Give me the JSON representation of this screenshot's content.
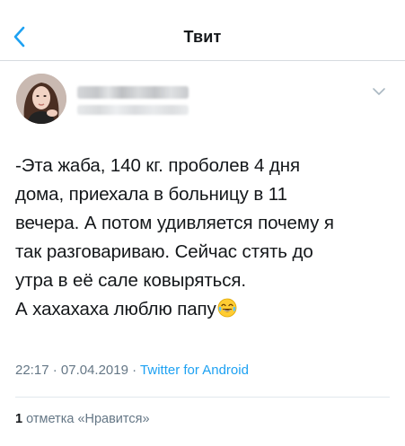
{
  "header": {
    "title": "Твит",
    "back_icon": "chevron-left-icon",
    "accent_color": "#1da1f2"
  },
  "tweet": {
    "author_name_hidden": true,
    "lines": [
      "-Эта жаба, 140 кг. проболев 4 дня",
      "дома, приехала в больницу в 11",
      "вечера. А потом удивляется почему я",
      "так разговариваю. Сейчас стять до",
      "утра в её сале ковыряться.",
      "А хахахаха люблю папу"
    ],
    "emoji": "face-with-tears-of-joy-icon",
    "time": "22:17",
    "date": "07.04.2019",
    "separator": "·",
    "client": "Twitter for Android",
    "likes_count": "1",
    "likes_label": "отметка «Нравится»"
  }
}
